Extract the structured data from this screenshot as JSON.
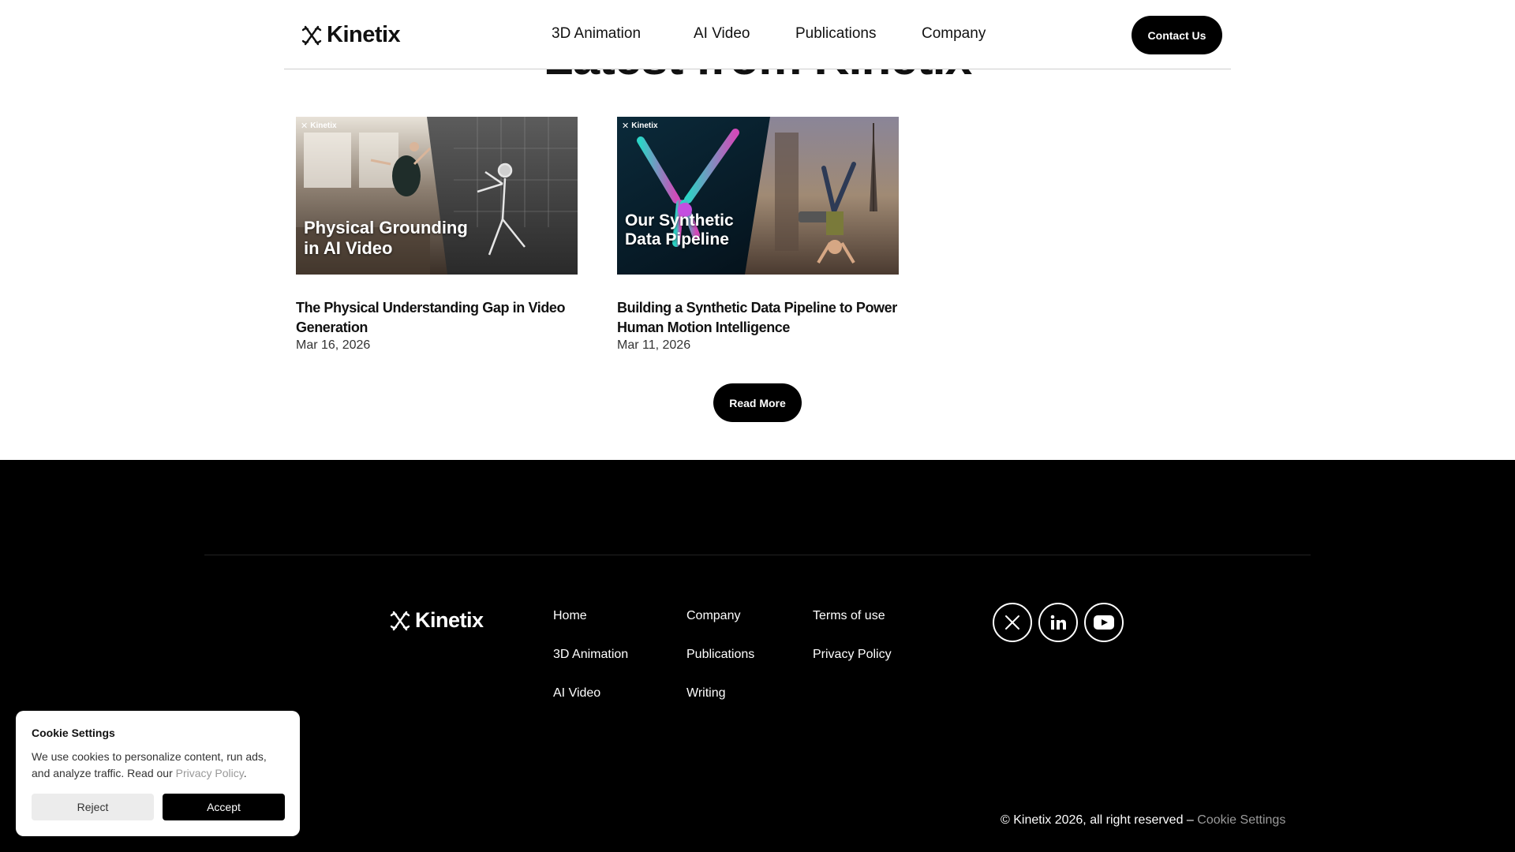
{
  "header": {
    "brand": "Kinetix",
    "nav": [
      "3D Animation",
      "AI Video",
      "Publications",
      "Company"
    ],
    "contact_label": "Contact Us"
  },
  "main": {
    "heading": "Latest from Kinetix",
    "cards": [
      {
        "thumb_brand": "Kinetix",
        "caption_line1": "Physical Grounding",
        "caption_line2": "in AI Video",
        "title": "The Physical Understanding Gap in Video Generation",
        "date": "Mar 16, 2026"
      },
      {
        "thumb_brand": "Kinetix",
        "caption_line1": "Our Synthetic",
        "caption_line2": "Data Pipeline",
        "title": "Building a Synthetic Data Pipeline to Power Human Motion Intelligence",
        "date": "Mar 11, 2026"
      }
    ],
    "read_more_label": "Read More"
  },
  "footer": {
    "brand": "Kinetix",
    "col1": [
      "Home",
      "3D Animation",
      "AI Video"
    ],
    "col2": [
      "Company",
      "Publications",
      "Writing"
    ],
    "col3": [
      "Terms of use",
      "Privacy Policy"
    ],
    "social": [
      "x-icon",
      "linkedin-icon",
      "youtube-icon"
    ],
    "copyright": "© Kinetix 2026, all right reserved –",
    "cookie_settings_link": "Cookie Settings"
  },
  "cookie_banner": {
    "title": "Cookie Settings",
    "text": "We use cookies to personalize content, run ads, and analyze traffic. Read our",
    "privacy_link": "Privacy Policy",
    "text_end": ".",
    "reject_label": "Reject",
    "accept_label": "Accept"
  },
  "colors": {
    "black": "#000000",
    "white": "#ffffff",
    "muted_link": "#9a9a9a"
  }
}
